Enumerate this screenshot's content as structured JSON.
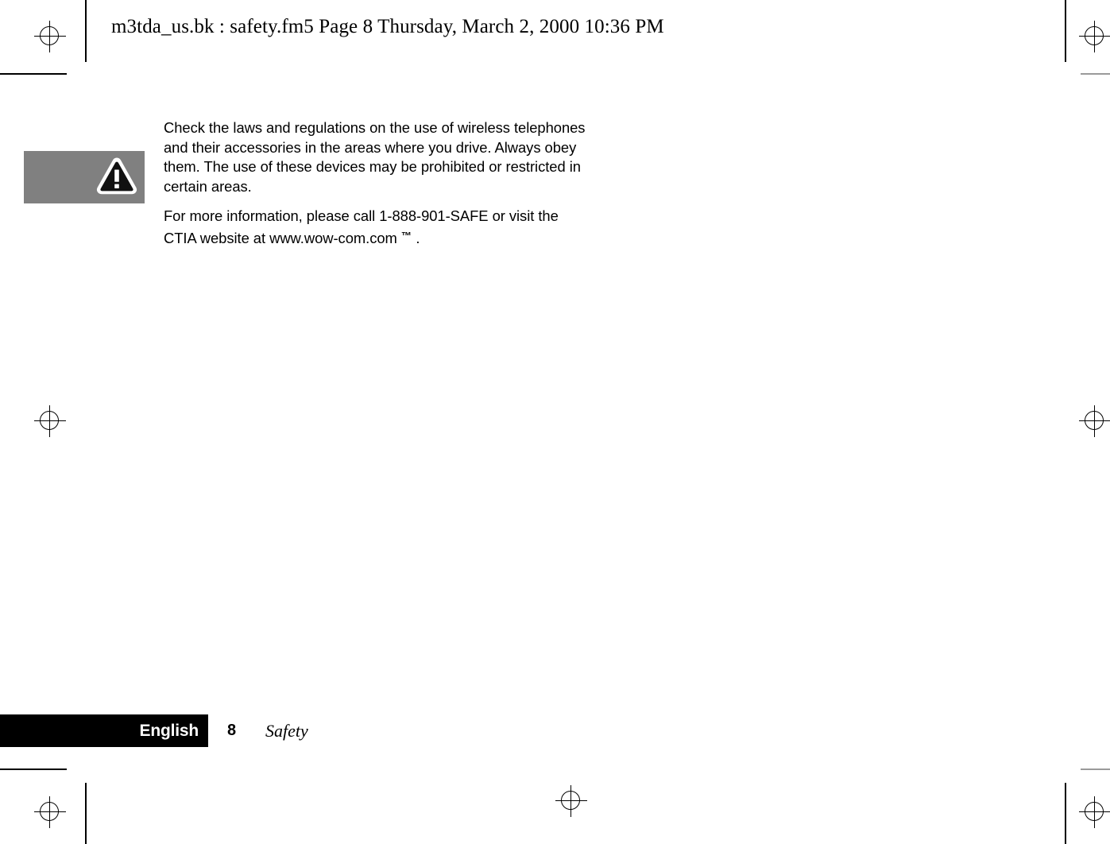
{
  "page_header": {
    "text": "m3tda_us.bk : safety.fm5  Page 8  Thursday, March 2, 2000  10:36 PM"
  },
  "note": {
    "icon_name": "warning-triangle-icon",
    "icon_box_color": "#808080",
    "paragraphs": [
      "Check the laws and regulations on the use of wireless telephones and their accessories in the areas where you drive. Always obey them. The use of these devices may be prohibited or restricted in certain areas.",
      "For more information, please call 1-888-901-SAFE or visit the CTIA website at www.wow-com.com"
    ],
    "trademark_symbol": "™",
    "trailing_punctuation": "."
  },
  "footer": {
    "language_label": "English",
    "page_number": "8",
    "section_label": "Safety",
    "bar_color": "#000000"
  },
  "print_marks": {
    "registration_mark_name": "registration-crosshair-mark",
    "crop_mark_name": "crop-mark"
  }
}
